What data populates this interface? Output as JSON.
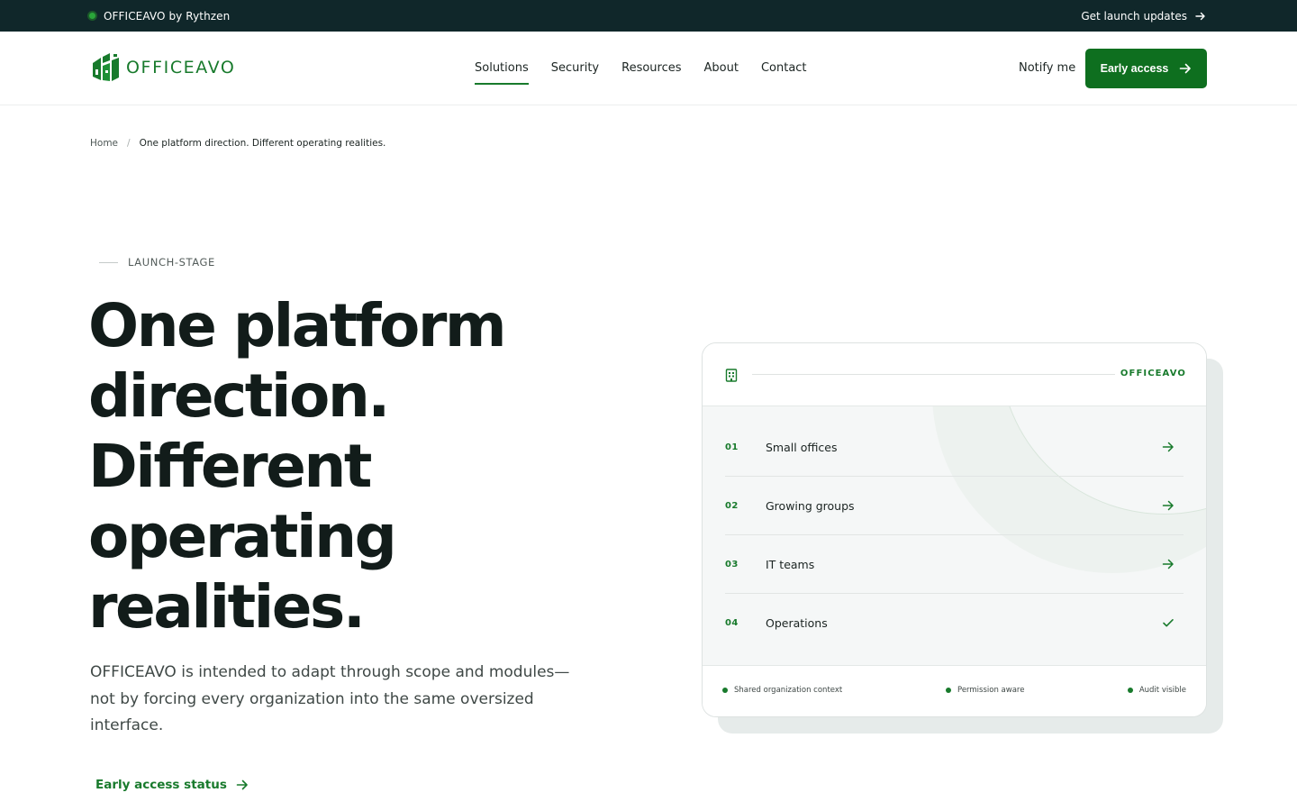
{
  "topbar": {
    "brand": "OFFICEAVO by Rythzen",
    "updates_link": "Get launch updates"
  },
  "nav": {
    "logo_text": "OFFICEAVO",
    "links": [
      "Solutions",
      "Security",
      "Resources",
      "About",
      "Contact"
    ],
    "active_link": "Solutions",
    "notify": "Notify me",
    "cta": "Early access"
  },
  "breadcrumb": {
    "home": "Home",
    "separator": "/",
    "current": "One platform direction. Different operating realities."
  },
  "hero": {
    "eyebrow": "LAUNCH-STAGE",
    "title": "One platform direction. Different operating realities.",
    "subtitle": "OFFICEAVO is intended to adapt through scope and modules—not by forcing every organization into the same oversized interface.",
    "status_link": "Early access status"
  },
  "card": {
    "brand": "OFFICEAVO",
    "rows": [
      {
        "num": "01",
        "label": "Small offices",
        "icon": "arrow-right-icon"
      },
      {
        "num": "02",
        "label": "Growing groups",
        "icon": "arrow-right-icon"
      },
      {
        "num": "03",
        "label": "IT teams",
        "icon": "arrow-right-icon"
      },
      {
        "num": "04",
        "label": "Operations",
        "icon": "check-icon"
      }
    ],
    "tags": [
      "Shared organization context",
      "Permission aware",
      "Audit visible"
    ]
  },
  "colors": {
    "brand_green": "#187a2c",
    "cta_green": "#0e6f1f",
    "topbar_bg": "#10272a",
    "text_dark": "#121c1a"
  }
}
